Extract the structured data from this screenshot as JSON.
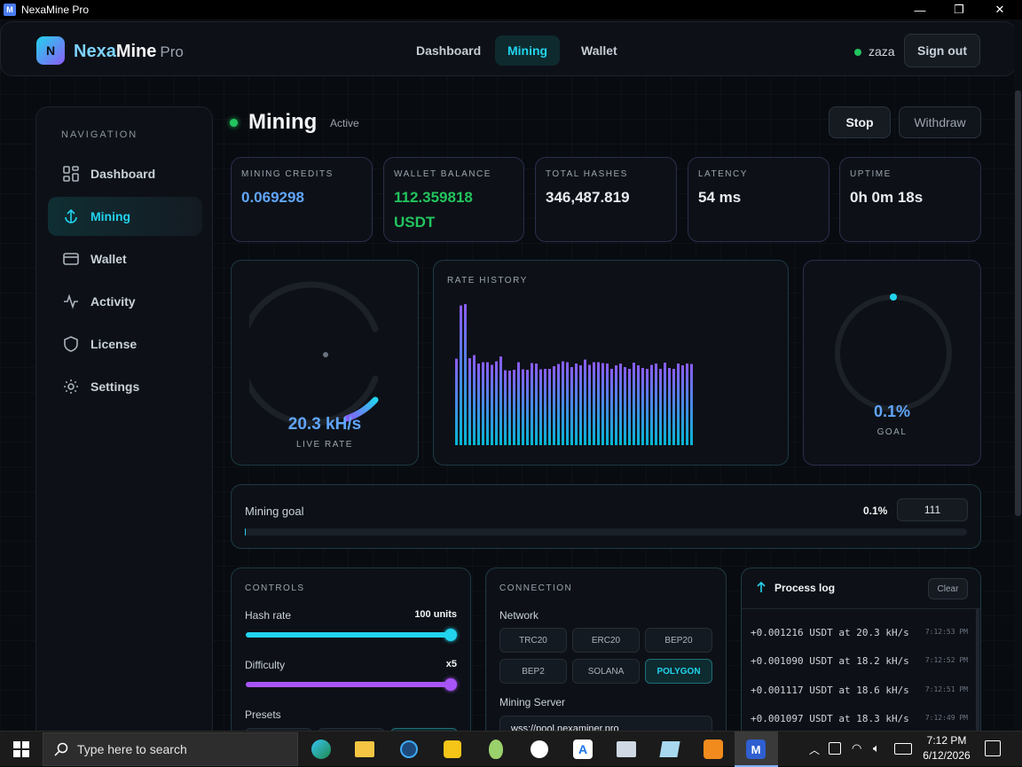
{
  "window": {
    "title": "NexaMine Pro",
    "minimize": "—",
    "maximize": "❐",
    "close": "✕"
  },
  "brand": {
    "logo_letter": "N",
    "part1": "Nexa",
    "part2": "Mine",
    "suffix": "Pro"
  },
  "topnav": {
    "items": [
      {
        "label": "Dashboard"
      },
      {
        "label": "Mining",
        "active": true
      },
      {
        "label": "Wallet"
      }
    ]
  },
  "user": {
    "name": "zaza",
    "status_color": "#22c55e",
    "signout": "Sign out"
  },
  "sidebar": {
    "heading": "NAVIGATION",
    "items": [
      {
        "label": "Dashboard",
        "icon": "grid-icon"
      },
      {
        "label": "Mining",
        "icon": "anchor-icon",
        "active": true
      },
      {
        "label": "Wallet",
        "icon": "wallet-icon"
      },
      {
        "label": "Activity",
        "icon": "activity-icon"
      },
      {
        "label": "License",
        "icon": "shield-icon"
      },
      {
        "label": "Settings",
        "icon": "gear-icon"
      }
    ]
  },
  "page": {
    "title": "Mining",
    "status": "Active",
    "stop": "Stop",
    "withdraw": "Withdraw"
  },
  "stats": [
    {
      "label": "MINING CREDITS",
      "value": "0.069298",
      "color": "#60a5fa"
    },
    {
      "label": "WALLET BALANCE",
      "value": "112.359818",
      "value2": "USDT",
      "color": "#22c55e"
    },
    {
      "label": "TOTAL HASHES",
      "value": "346,487.819",
      "color": "#f3f4f6"
    },
    {
      "label": "LATENCY",
      "value": "54 ms",
      "color": "#f3f4f6"
    },
    {
      "label": "UPTIME",
      "value": "0h 0m 18s",
      "color": "#f3f4f6"
    }
  ],
  "gauge": {
    "value": "20.3 kH/s",
    "label": "LIVE RATE"
  },
  "rate_history": {
    "label": "RATE HISTORY"
  },
  "goal_ring": {
    "value": "0.1%",
    "label": "GOAL",
    "fraction": 0.001
  },
  "mining_goal": {
    "label": "Mining goal",
    "percent": "0.1%",
    "target": "111",
    "fraction": 0.001
  },
  "controls": {
    "heading": "CONTROLS",
    "hash_rate_label": "Hash rate",
    "hash_rate_value": "100 units",
    "hash_rate_fraction": 1.0,
    "difficulty_label": "Difficulty",
    "difficulty_value": "x5",
    "difficulty_fraction": 1.0,
    "presets_label": "Presets"
  },
  "connection": {
    "heading": "CONNECTION",
    "network_label": "Network",
    "networks": [
      "TRC20",
      "ERC20",
      "BEP20",
      "BEP2",
      "SOLANA",
      "POLYGON"
    ],
    "active_network": "POLYGON",
    "server_label": "Mining Server",
    "server_value": "wss://pool.nexaminer.pro"
  },
  "process_log": {
    "title": "Process log",
    "clear": "Clear",
    "entries": [
      {
        "text": "+0.001216 USDT at 20.3 kH/s",
        "time": "7:12:53 PM"
      },
      {
        "text": "+0.001090 USDT at 18.2 kH/s",
        "time": "7:12:52 PM"
      },
      {
        "text": "+0.001117 USDT at 18.6 kH/s",
        "time": "7:12:51 PM"
      },
      {
        "text": "+0.001097 USDT at 18.3 kH/s",
        "time": "7:12:49 PM"
      }
    ]
  },
  "chart_data": {
    "type": "bar",
    "title": "RATE HISTORY",
    "values": [
      19.5,
      31.5,
      31.8,
      19.6,
      20.3,
      18.4,
      18.7,
      18.7,
      18.1,
      18.9,
      20.0,
      16.9,
      16.8,
      17.0,
      18.7,
      17.1,
      17.0,
      18.5,
      18.4,
      17.1,
      17.2,
      17.2,
      17.8,
      18.3,
      18.9,
      18.7,
      17.6,
      18.4,
      18.0,
      19.3,
      18.1,
      18.7,
      18.7,
      18.5,
      18.4,
      17.2,
      18.0,
      18.4,
      17.6,
      17.2,
      18.6,
      18.0,
      17.4,
      17.2,
      18.1,
      18.4,
      17.2,
      18.6,
      17.4,
      17.2,
      18.4,
      18.0,
      18.4,
      18.3
    ],
    "ylim": [
      0,
      34
    ],
    "colors": {
      "top": "#8b5cf6",
      "bottom": "#06b6d4"
    }
  },
  "taskbar": {
    "search_placeholder": "Type here to search",
    "time": "7:12 PM",
    "date": "6/12/2026"
  }
}
